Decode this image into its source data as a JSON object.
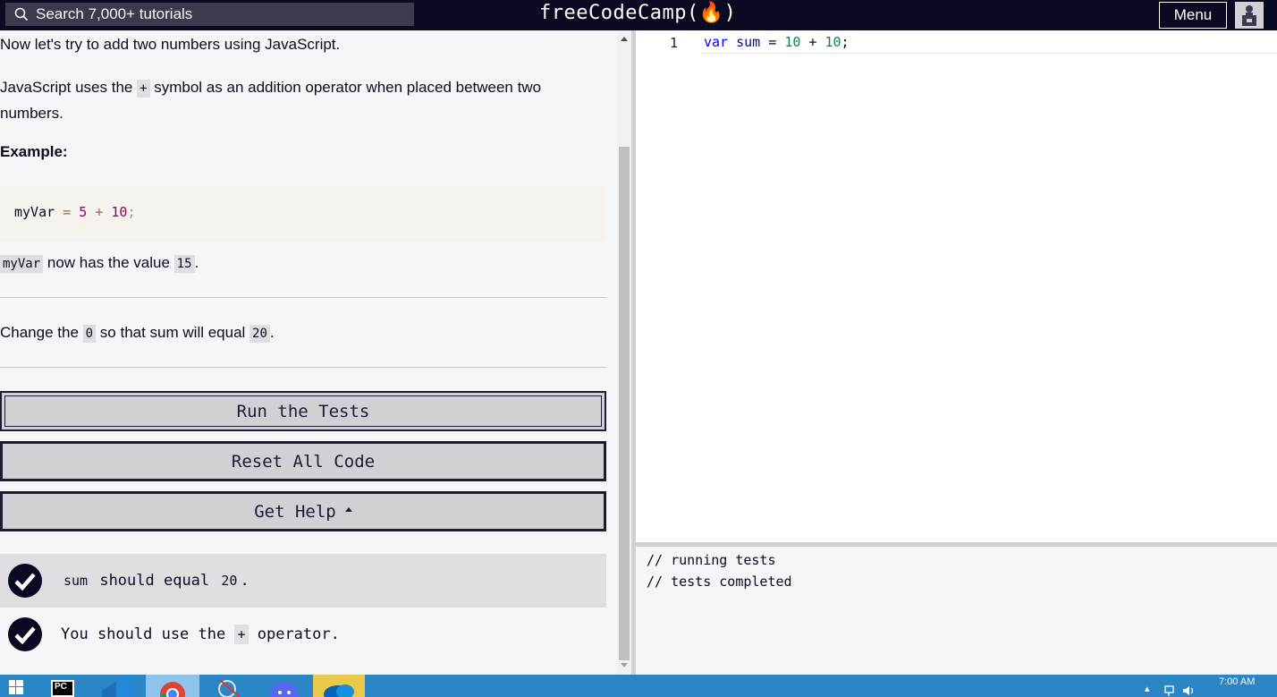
{
  "header": {
    "search_placeholder": "Search 7,000+ tutorials",
    "brand": "freeCodeCamp(🔥)",
    "menu_label": "Menu"
  },
  "lesson": {
    "p1": "Now let's try to add two numbers using JavaScript.",
    "p2_before": "JavaScript uses the ",
    "p2_code": "+",
    "p2_after": " symbol as an addition operator when placed between two numbers.",
    "example_title": "Example:",
    "example_code": {
      "var": "myVar",
      "eq": "=",
      "a": "5",
      "plus": "+",
      "b": "10",
      "semi": ";"
    },
    "p3_code1": "myVar",
    "p3_text": " now has the value ",
    "p3_code2": "15",
    "p3_end": ".",
    "task_before": "Change the ",
    "task_code1": "0",
    "task_mid": " so that sum will equal ",
    "task_code2": "20",
    "task_end": "."
  },
  "buttons": {
    "run": "Run the Tests",
    "reset": "Reset All Code",
    "help": "Get Help"
  },
  "tests": [
    {
      "code": "sum",
      "text": " should equal ",
      "code2": "20",
      "end": "."
    },
    {
      "text": "You should use the ",
      "code": "+",
      "end": " operator."
    }
  ],
  "editor": {
    "line_number": "1",
    "tokens": {
      "kw": "var",
      "ident": "sum",
      "eq": "=",
      "a": "10",
      "plus": "+",
      "b": "10",
      "semi": ";"
    }
  },
  "console": {
    "lines": [
      "// running tests",
      "// tests completed"
    ]
  },
  "taskbar": {
    "clock": "7:00 AM",
    "pycharm_label": "PC"
  },
  "colors": {
    "nav_bg": "#0a0a23",
    "button_bg": "#d0d0d5",
    "taskbar_bg": "#2b86c5"
  }
}
